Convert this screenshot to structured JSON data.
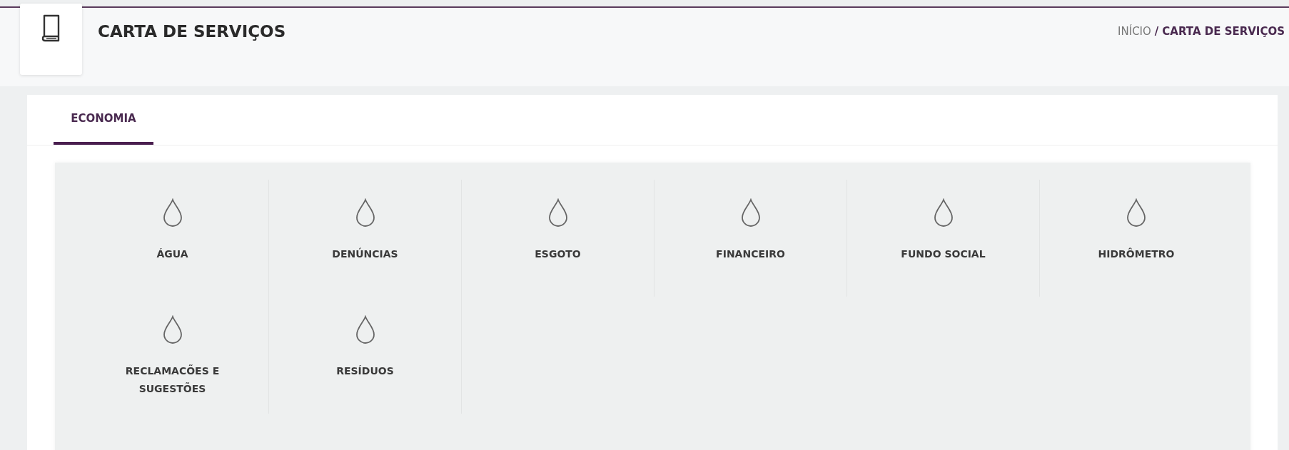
{
  "header": {
    "title": "CARTA DE SERVIÇOS",
    "breadcrumb": {
      "home": "INÍCIO",
      "separator": "/",
      "current": "CARTA DE SERVIÇOS"
    }
  },
  "tabs": [
    {
      "label": "ECONOMIA",
      "selected": true
    }
  ],
  "services": [
    {
      "label": "ÁGUA"
    },
    {
      "label": "DENÚNCIAS"
    },
    {
      "label": "ESGOTO"
    },
    {
      "label": "FINANCEIRO"
    },
    {
      "label": "FUNDO SOCIAL"
    },
    {
      "label": "HIDRÔMETRO"
    },
    {
      "label": "RECLAMACÕES E SUGESTÕES"
    },
    {
      "label": "RESÍDUOS"
    }
  ]
}
